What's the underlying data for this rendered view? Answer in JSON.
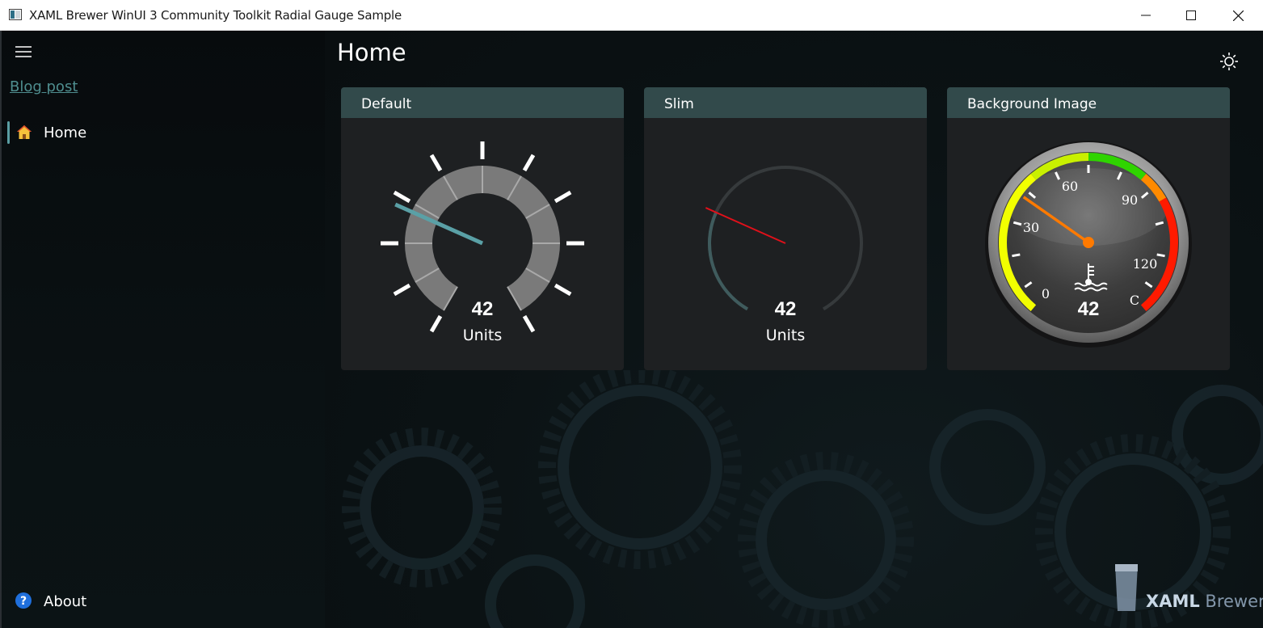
{
  "window": {
    "title": "XAML Brewer WinUI 3 Community Toolkit Radial Gauge Sample",
    "controls": [
      "minimize-icon",
      "maximize-icon",
      "close-icon"
    ]
  },
  "sidebar": {
    "menu_icon": "hamburger-icon",
    "blog_link": "Blog post",
    "items": [
      {
        "label": "Home",
        "icon": "home-icon",
        "selected": true
      },
      {
        "label": "About",
        "icon": "help-icon",
        "selected": false
      }
    ],
    "accent_color": "#5a9ea3",
    "link_color": "#4f8e8f"
  },
  "page": {
    "title": "Home",
    "theme_toggle_icon": "brightness-icon"
  },
  "cards": [
    {
      "header": "Default",
      "value": "42",
      "units": "Units"
    },
    {
      "header": "Slim",
      "value": "42",
      "units": "Units"
    },
    {
      "header": "Background Image",
      "value": "42",
      "scale_labels": [
        "0",
        "30",
        "60",
        "90",
        "120",
        "C"
      ],
      "icon": "thermometer-icon"
    }
  ],
  "gauge_settings": {
    "minimum": 0,
    "maximum": 150,
    "value": 42
  },
  "branding": {
    "word1": "XAML",
    "word2": "Brewer",
    "icon": "glass-icon"
  },
  "colors": {
    "card_header": "#324a4b",
    "card_body": "#1e2022",
    "default_needle": "#5aa0a6",
    "slim_needle": "#e0101a",
    "image_needle": "#ff7a00"
  }
}
